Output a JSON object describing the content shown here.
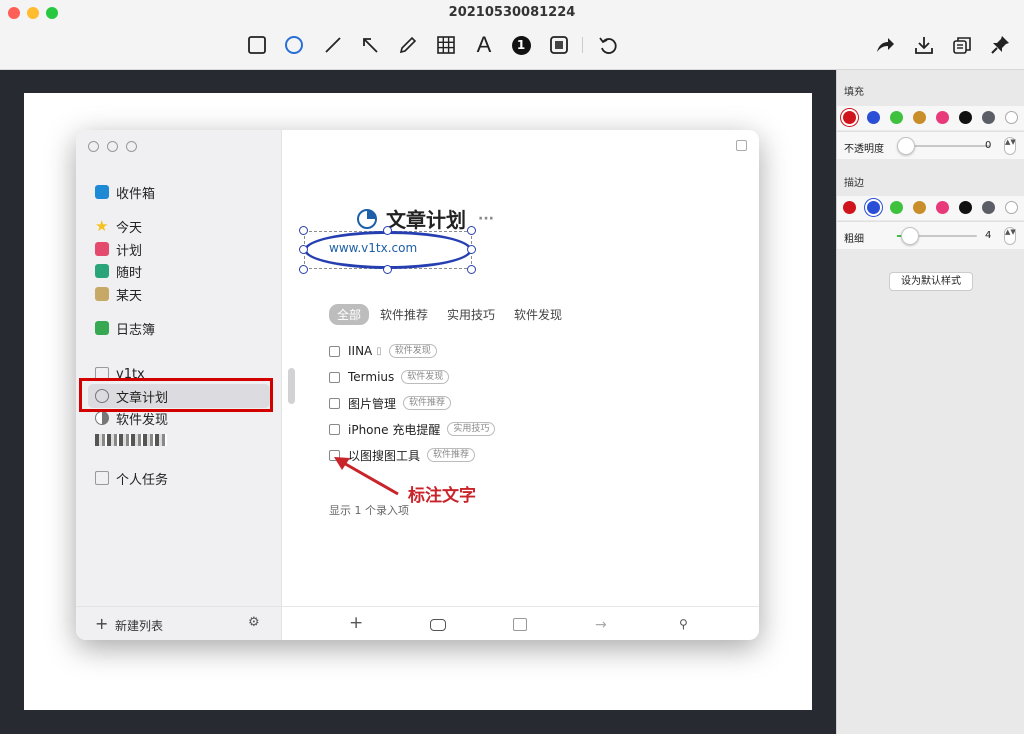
{
  "window": {
    "title": "20210530081224"
  },
  "toolbar": {
    "tools": [
      "rectangle-icon",
      "ellipse-icon",
      "line-icon",
      "arrow-icon",
      "pencil-icon",
      "mosaic-grid-icon",
      "text-icon",
      "counter-icon",
      "highlight-icon",
      "undo-icon"
    ],
    "counter_label": "1",
    "text_tool_label": "A",
    "right_tools": [
      "share-icon",
      "download-icon",
      "copy-icon",
      "pin-icon"
    ]
  },
  "panel": {
    "fill_title": "填充",
    "fill_colors": [
      "#d0141b",
      "#2a4fd6",
      "#3ec23e",
      "#c98d2a",
      "#e8397a",
      "#111111",
      "#5b5e66",
      "#ffffff"
    ],
    "opacity_label": "不透明度",
    "opacity_value": "0",
    "stroke_title": "描边",
    "stroke_colors": [
      "#d0141b",
      "#2a4fd6",
      "#3ec23e",
      "#c98d2a",
      "#e8397a",
      "#111111",
      "#5b5e66",
      "#ffffff"
    ],
    "thickness_label": "粗细",
    "thickness_value": "4",
    "default_button": "设为默认样式"
  },
  "inner": {
    "sidebar": {
      "inbox": "收件箱",
      "today": "今天",
      "plan": "计划",
      "anytime": "随时",
      "someday": "某天",
      "logbook": "日志簿",
      "area": "v1tx",
      "project_selected": "文章计划",
      "project_2": "软件发现",
      "personal": "个人任务",
      "new_list": "新建列表"
    },
    "main": {
      "title": "文章计划",
      "more": "···",
      "link": "www.v1tx.com",
      "tabs": [
        "全部",
        "软件推荐",
        "实用技巧",
        "软件发现"
      ],
      "tasks": [
        {
          "name": "IINA",
          "tag": "软件发现"
        },
        {
          "name": "Termius",
          "tag": "软件发现"
        },
        {
          "name": "图片管理",
          "tag": "软件推荐"
        },
        {
          "name": "iPhone 充电提醒",
          "tag": "实用技巧"
        },
        {
          "name": "以图搜图工具",
          "tag": "软件推荐"
        }
      ],
      "count": "显示 1 个录入项"
    }
  },
  "annotation": {
    "text": "标注文字",
    "color": "#c8242a"
  }
}
